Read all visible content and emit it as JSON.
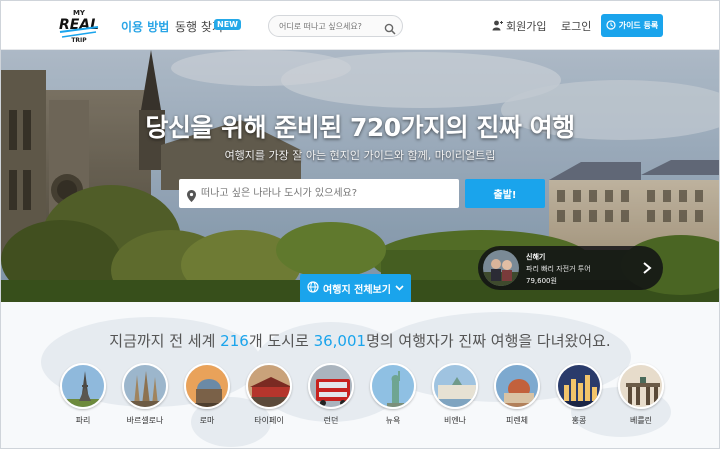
{
  "header": {
    "logo": {
      "line1": "MY",
      "line2": "REAL",
      "line3": "TRIP"
    },
    "nav": [
      {
        "label": "이용 방법"
      },
      {
        "label": "동행 찾기",
        "badge": "NEW"
      }
    ],
    "search": {
      "placeholder": "어디로 떠나고 싶으세요?"
    },
    "signup_label": "회원가입",
    "login_label": "로그인",
    "guide_button": "가이드 등록"
  },
  "hero": {
    "title": "당신을 위해 준비된 720가지의 진짜 여행",
    "subtitle": "여행지를 가장 잘 아는 현지인 가이드와 함께, 마이리얼트립",
    "search_placeholder": "떠나고 싶은 나라나 도시가 있으세요?",
    "depart_button": "출발!",
    "view_all": "여행지 전체보기",
    "tour_card": {
      "guide_name": "신해기",
      "tour_title": "파리 빠리 자전거 투어",
      "price": "79,600원"
    }
  },
  "stats": {
    "prefix": "지금까지 전 세계 ",
    "cities_count": "216",
    "middle": "개 도시로 ",
    "travelers_count": "36,001",
    "suffix": "명의 여행자가 진짜 여행을 다녀왔어요."
  },
  "cities": [
    {
      "name": "파리"
    },
    {
      "name": "바르셀로나"
    },
    {
      "name": "로마"
    },
    {
      "name": "타이페이"
    },
    {
      "name": "런던"
    },
    {
      "name": "뉴욕"
    },
    {
      "name": "비엔나"
    },
    {
      "name": "피렌체"
    },
    {
      "name": "홍콩"
    },
    {
      "name": "베를린"
    }
  ],
  "colors": {
    "accent": "#1aa4ec",
    "text": "#333333",
    "badge": "#25a9e8"
  }
}
